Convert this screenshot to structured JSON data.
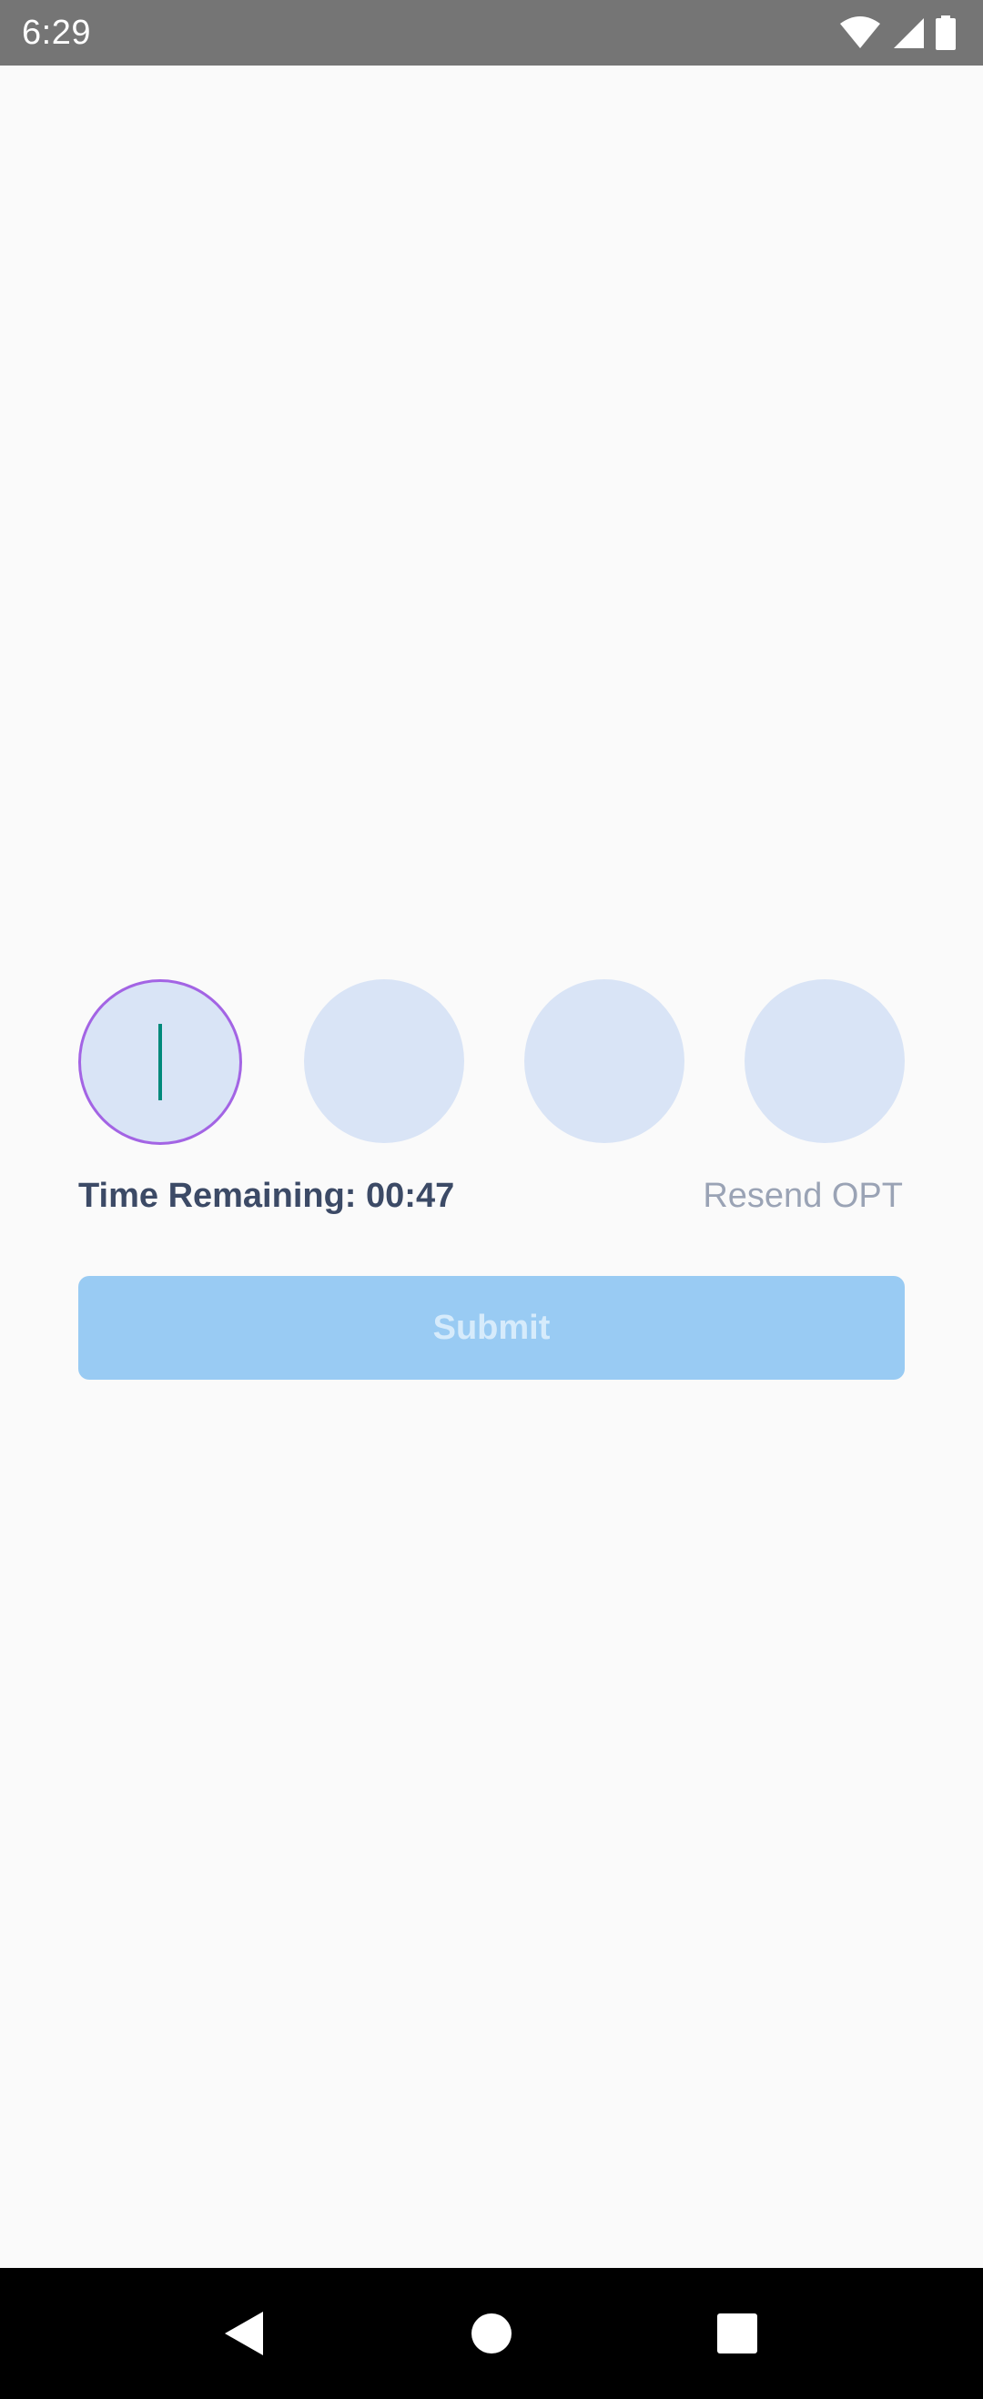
{
  "status_bar": {
    "time": "6:29",
    "icons": [
      "wifi-icon",
      "cellular-signal-icon",
      "battery-icon"
    ]
  },
  "otp": {
    "digits": [
      "",
      "",
      "",
      ""
    ],
    "active_index": 0
  },
  "timer": {
    "text": "Time Remaining: 00:47"
  },
  "resend": {
    "label": "Resend OPT"
  },
  "submit": {
    "label": "Submit",
    "enabled": false
  },
  "nav_bar": {
    "buttons": [
      "back-icon",
      "home-icon",
      "recents-icon"
    ]
  },
  "colors": {
    "status_bar": "#757575",
    "background": "#fafafa",
    "otp_box_fill": "#d9e4f6",
    "otp_active_border": "#a364e4",
    "cursor": "#00897b",
    "timer_text": "#3c4a66",
    "resend_text": "#9aa3b5",
    "submit_fill": "#99cbf3",
    "submit_text": "#d6ebfb"
  }
}
